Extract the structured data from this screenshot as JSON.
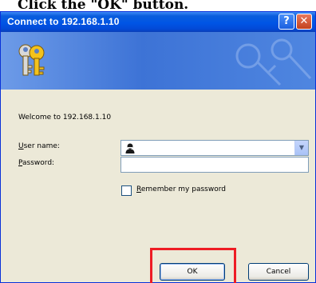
{
  "caption": "Click the \"OK\" button.",
  "dialog": {
    "title": "Connect to 192.168.1.10",
    "help_label": "?",
    "close_label": "✕",
    "welcome": "Welcome to 192.168.1.10",
    "username_label_access": "U",
    "username_label_rest": "ser name:",
    "password_label_access": "P",
    "password_label_rest": "assword:",
    "username_value": "",
    "password_value": "",
    "remember_label_access": "R",
    "remember_label_rest": "emember my password",
    "remember_checked": false,
    "ok_label": "OK",
    "cancel_label": "Cancel",
    "highlight_color": "#ee1c24"
  }
}
